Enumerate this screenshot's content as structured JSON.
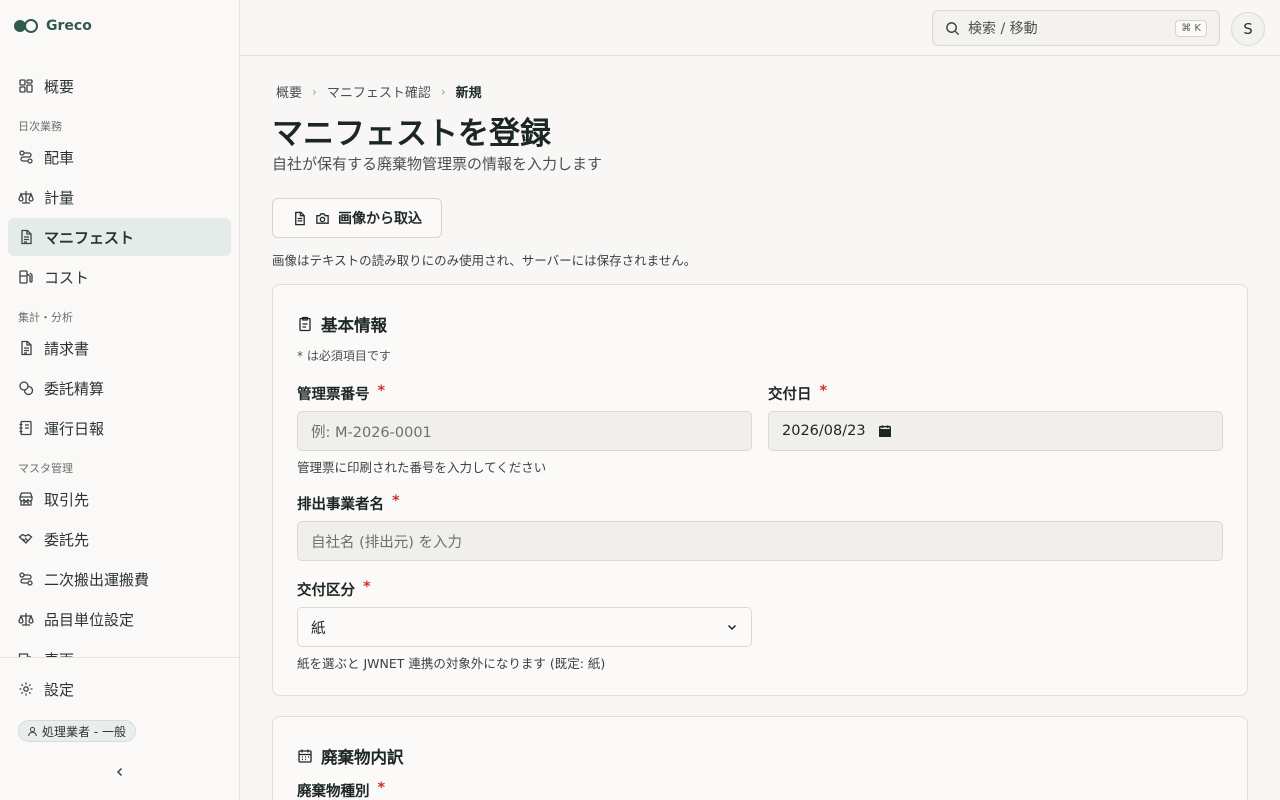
{
  "brand": {
    "name": "Greco"
  },
  "sidebar": {
    "top_items": [
      {
        "label": "概要",
        "icon": "dashboard-icon"
      }
    ],
    "sections": [
      {
        "title": "日次業務",
        "items": [
          {
            "label": "配車",
            "icon": "route-icon"
          },
          {
            "label": "計量",
            "icon": "scale-icon"
          },
          {
            "label": "マニフェスト",
            "icon": "document-icon",
            "active": true
          },
          {
            "label": "コスト",
            "icon": "fuel-icon"
          }
        ]
      },
      {
        "title": "集計・分析",
        "items": [
          {
            "label": "請求書",
            "icon": "document-icon"
          },
          {
            "label": "委託精算",
            "icon": "coins-icon"
          },
          {
            "label": "運行日報",
            "icon": "notebook-icon"
          }
        ]
      },
      {
        "title": "マスタ管理",
        "items": [
          {
            "label": "取引先",
            "icon": "store-icon"
          },
          {
            "label": "委託先",
            "icon": "handshake-icon"
          },
          {
            "label": "二次搬出運搬費",
            "icon": "route-icon"
          },
          {
            "label": "品目単位設定",
            "icon": "scale-icon"
          },
          {
            "label": "車両",
            "icon": "truck-icon"
          }
        ]
      }
    ],
    "settings_label": "設定",
    "role_label": "処理業者 - 一般"
  },
  "header": {
    "search_placeholder": "検索 / 移動",
    "shortcut": "⌘ K",
    "avatar_initial": "S"
  },
  "breadcrumb": [
    "概要",
    "マニフェスト確認",
    "新規"
  ],
  "page": {
    "title": "マニフェストを登録",
    "subtitle": "自社が保有する廃棄物管理票の情報を入力します",
    "import_button": "画像から取込",
    "import_note": "画像はテキストの読み取りにのみ使用され、サーバーには保存されません。"
  },
  "basic_info": {
    "title": "基本情報",
    "required_note": "* は必須項目です",
    "manifest_no": {
      "label": "管理票番号",
      "placeholder": "例: M-2026-0001",
      "hint": "管理票に印刷された番号を入力してください"
    },
    "issue_date": {
      "label": "交付日",
      "value": "2026/08/23"
    },
    "discharger": {
      "label": "排出事業者名",
      "placeholder": "自社名 (排出元) を入力"
    },
    "issue_type": {
      "label": "交付区分",
      "value": "紙",
      "hint": "紙を選ぶと JWNET 連携の対象外になります (既定: 紙)"
    }
  },
  "waste_breakdown": {
    "title": "廃棄物内訳",
    "waste_type": {
      "label": "廃棄物種別"
    }
  }
}
